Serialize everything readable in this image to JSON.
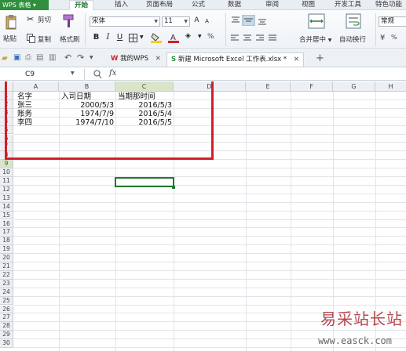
{
  "app": {
    "title": "WPS 表格",
    "dropdown_icon": "chevron-down-icon"
  },
  "menu": {
    "tabs": [
      "开始",
      "插入",
      "页面布局",
      "公式",
      "数据",
      "审阅",
      "视图",
      "开发工具",
      "特色功能"
    ],
    "active": "开始"
  },
  "ribbon": {
    "cut": "剪切",
    "paste": "粘贴",
    "copy": "复制",
    "format_painter": "格式刷",
    "font_name": "宋体",
    "font_size": "11",
    "bold": "B",
    "italic": "I",
    "underline": "U",
    "merge_center": "合并居中",
    "wrap": "自动换行",
    "number_format": "常规",
    "percent": "%",
    "currency": "¥"
  },
  "doc_tabs": [
    {
      "label": "我的WPS",
      "active": false
    },
    {
      "label": "新建 Microsoft Excel 工作表.xlsx *",
      "active": true
    }
  ],
  "add_tab": "+",
  "formula_bar": {
    "cell_ref": "C9",
    "fx": "fx",
    "value": ""
  },
  "columns": [
    "A",
    "B",
    "C",
    "D",
    "E",
    "F",
    "G",
    "H"
  ],
  "selected_column": "C",
  "rows": [
    "1",
    "2",
    "3",
    "4",
    "5",
    "6",
    "7",
    "8",
    "9",
    "10",
    "11",
    "12",
    "13",
    "14",
    "15",
    "16",
    "17",
    "18",
    "19",
    "20",
    "21",
    "22",
    "23",
    "24",
    "25",
    "26",
    "27",
    "28",
    "29",
    "30"
  ],
  "selected_row": "9",
  "sheet": {
    "a1": "名字",
    "b1": "入司日期",
    "c1": "当期那时间",
    "a2": "张三",
    "b2": "2000/5/3",
    "c2": "2016/5/3",
    "a3": "账务",
    "b3": "1974/7/9",
    "c3": "2016/5/4",
    "a4": "李四",
    "b4": "1974/7/10",
    "c4": "2016/5/5"
  },
  "watermark": {
    "title": "易采站长站",
    "url": "www.easck.com"
  },
  "colors": {
    "accent": "#2f8f3d",
    "highlight_box": "#d0202a",
    "selection": "#1f7a32"
  }
}
